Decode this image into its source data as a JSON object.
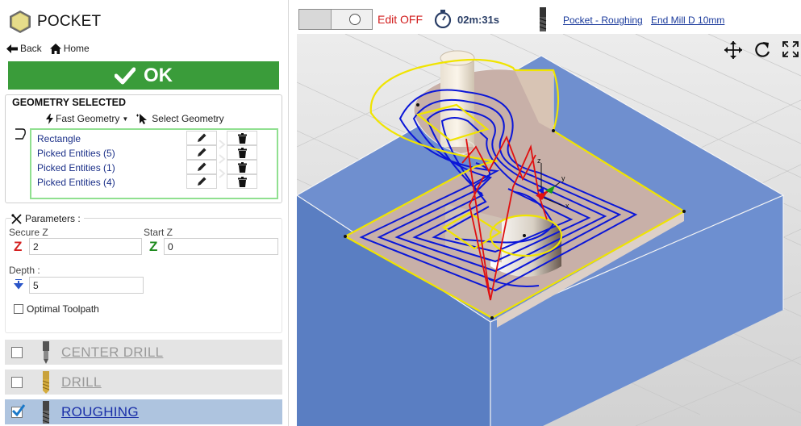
{
  "header": {
    "title": "POCKET"
  },
  "nav": {
    "back": "Back",
    "home": "Home"
  },
  "ok_button": {
    "label": "OK"
  },
  "geometry": {
    "title": "GEOMETRY SELECTED",
    "fast_geometry": "Fast Geometry",
    "select_geometry": "Select Geometry",
    "items": [
      {
        "label": "Rectangle"
      },
      {
        "label": "Picked Entities (5)"
      },
      {
        "label": "Picked Entities (1)"
      },
      {
        "label": "Picked Entities (4)"
      }
    ]
  },
  "parameters": {
    "title": "Parameters :",
    "secure_z": {
      "label": "Secure Z",
      "value": "2"
    },
    "start_z": {
      "label": "Start Z",
      "value": "0"
    },
    "depth": {
      "label": "Depth :",
      "value": "5"
    },
    "optimal_toolpath": {
      "label": "Optimal Toolpath",
      "checked": false
    }
  },
  "operations": [
    {
      "name": "CENTER DRILL",
      "checked": false,
      "selected": false
    },
    {
      "name": "DRILL",
      "checked": false,
      "selected": false
    },
    {
      "name": "ROUGHING",
      "checked": true,
      "selected": true
    }
  ],
  "toolbar": {
    "edit_status": "Edit OFF",
    "time": "02m:31s",
    "operation_link": "Pocket - Roughing",
    "tool_link": "End Mill D 10mm"
  },
  "viewport": {
    "axis_labels": {
      "x": "x",
      "y": "y",
      "z": "z"
    }
  },
  "colors": {
    "ok_green": "#3a9c3a",
    "edit_off_red": "#d11a1a",
    "block_blue": "#6e8fcc",
    "toolpath_blue": "#0a16d8",
    "contour_yellow": "#f0e400",
    "link_red": "#e01010"
  }
}
